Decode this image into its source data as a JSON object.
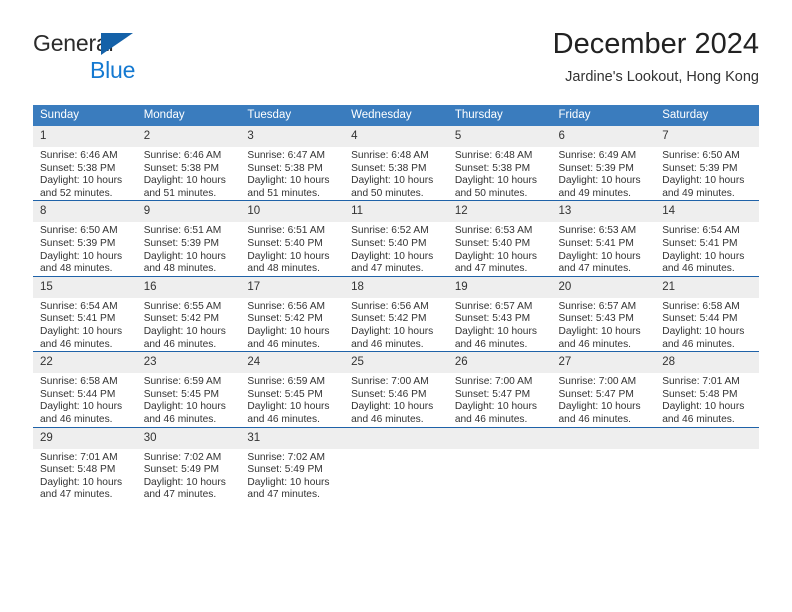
{
  "brand": {
    "name_part1": "General",
    "name_part2": "Blue",
    "flag_icon": "triangle-flag-icon",
    "color_dark": "#2b2b2b",
    "color_blue": "#1479d1",
    "flag_color": "#1461a8"
  },
  "header": {
    "month_title": "December 2024",
    "location": "Jardine's Lookout, Hong Kong"
  },
  "theme": {
    "header_bg": "#3a7cbe",
    "header_text": "#ffffff",
    "row_divider": "#1f62a8",
    "daynum_band": "#eeeeee",
    "body_text": "#333333"
  },
  "calendar": {
    "weekday_headers": [
      "Sunday",
      "Monday",
      "Tuesday",
      "Wednesday",
      "Thursday",
      "Friday",
      "Saturday"
    ],
    "weeks": [
      [
        {
          "day": "1",
          "sunrise": "Sunrise: 6:46 AM",
          "sunset": "Sunset: 5:38 PM",
          "daylight": "Daylight: 10 hours and 52 minutes."
        },
        {
          "day": "2",
          "sunrise": "Sunrise: 6:46 AM",
          "sunset": "Sunset: 5:38 PM",
          "daylight": "Daylight: 10 hours and 51 minutes."
        },
        {
          "day": "3",
          "sunrise": "Sunrise: 6:47 AM",
          "sunset": "Sunset: 5:38 PM",
          "daylight": "Daylight: 10 hours and 51 minutes."
        },
        {
          "day": "4",
          "sunrise": "Sunrise: 6:48 AM",
          "sunset": "Sunset: 5:38 PM",
          "daylight": "Daylight: 10 hours and 50 minutes."
        },
        {
          "day": "5",
          "sunrise": "Sunrise: 6:48 AM",
          "sunset": "Sunset: 5:38 PM",
          "daylight": "Daylight: 10 hours and 50 minutes."
        },
        {
          "day": "6",
          "sunrise": "Sunrise: 6:49 AM",
          "sunset": "Sunset: 5:39 PM",
          "daylight": "Daylight: 10 hours and 49 minutes."
        },
        {
          "day": "7",
          "sunrise": "Sunrise: 6:50 AM",
          "sunset": "Sunset: 5:39 PM",
          "daylight": "Daylight: 10 hours and 49 minutes."
        }
      ],
      [
        {
          "day": "8",
          "sunrise": "Sunrise: 6:50 AM",
          "sunset": "Sunset: 5:39 PM",
          "daylight": "Daylight: 10 hours and 48 minutes."
        },
        {
          "day": "9",
          "sunrise": "Sunrise: 6:51 AM",
          "sunset": "Sunset: 5:39 PM",
          "daylight": "Daylight: 10 hours and 48 minutes."
        },
        {
          "day": "10",
          "sunrise": "Sunrise: 6:51 AM",
          "sunset": "Sunset: 5:40 PM",
          "daylight": "Daylight: 10 hours and 48 minutes."
        },
        {
          "day": "11",
          "sunrise": "Sunrise: 6:52 AM",
          "sunset": "Sunset: 5:40 PM",
          "daylight": "Daylight: 10 hours and 47 minutes."
        },
        {
          "day": "12",
          "sunrise": "Sunrise: 6:53 AM",
          "sunset": "Sunset: 5:40 PM",
          "daylight": "Daylight: 10 hours and 47 minutes."
        },
        {
          "day": "13",
          "sunrise": "Sunrise: 6:53 AM",
          "sunset": "Sunset: 5:41 PM",
          "daylight": "Daylight: 10 hours and 47 minutes."
        },
        {
          "day": "14",
          "sunrise": "Sunrise: 6:54 AM",
          "sunset": "Sunset: 5:41 PM",
          "daylight": "Daylight: 10 hours and 46 minutes."
        }
      ],
      [
        {
          "day": "15",
          "sunrise": "Sunrise: 6:54 AM",
          "sunset": "Sunset: 5:41 PM",
          "daylight": "Daylight: 10 hours and 46 minutes."
        },
        {
          "day": "16",
          "sunrise": "Sunrise: 6:55 AM",
          "sunset": "Sunset: 5:42 PM",
          "daylight": "Daylight: 10 hours and 46 minutes."
        },
        {
          "day": "17",
          "sunrise": "Sunrise: 6:56 AM",
          "sunset": "Sunset: 5:42 PM",
          "daylight": "Daylight: 10 hours and 46 minutes."
        },
        {
          "day": "18",
          "sunrise": "Sunrise: 6:56 AM",
          "sunset": "Sunset: 5:42 PM",
          "daylight": "Daylight: 10 hours and 46 minutes."
        },
        {
          "day": "19",
          "sunrise": "Sunrise: 6:57 AM",
          "sunset": "Sunset: 5:43 PM",
          "daylight": "Daylight: 10 hours and 46 minutes."
        },
        {
          "day": "20",
          "sunrise": "Sunrise: 6:57 AM",
          "sunset": "Sunset: 5:43 PM",
          "daylight": "Daylight: 10 hours and 46 minutes."
        },
        {
          "day": "21",
          "sunrise": "Sunrise: 6:58 AM",
          "sunset": "Sunset: 5:44 PM",
          "daylight": "Daylight: 10 hours and 46 minutes."
        }
      ],
      [
        {
          "day": "22",
          "sunrise": "Sunrise: 6:58 AM",
          "sunset": "Sunset: 5:44 PM",
          "daylight": "Daylight: 10 hours and 46 minutes."
        },
        {
          "day": "23",
          "sunrise": "Sunrise: 6:59 AM",
          "sunset": "Sunset: 5:45 PM",
          "daylight": "Daylight: 10 hours and 46 minutes."
        },
        {
          "day": "24",
          "sunrise": "Sunrise: 6:59 AM",
          "sunset": "Sunset: 5:45 PM",
          "daylight": "Daylight: 10 hours and 46 minutes."
        },
        {
          "day": "25",
          "sunrise": "Sunrise: 7:00 AM",
          "sunset": "Sunset: 5:46 PM",
          "daylight": "Daylight: 10 hours and 46 minutes."
        },
        {
          "day": "26",
          "sunrise": "Sunrise: 7:00 AM",
          "sunset": "Sunset: 5:47 PM",
          "daylight": "Daylight: 10 hours and 46 minutes."
        },
        {
          "day": "27",
          "sunrise": "Sunrise: 7:00 AM",
          "sunset": "Sunset: 5:47 PM",
          "daylight": "Daylight: 10 hours and 46 minutes."
        },
        {
          "day": "28",
          "sunrise": "Sunrise: 7:01 AM",
          "sunset": "Sunset: 5:48 PM",
          "daylight": "Daylight: 10 hours and 46 minutes."
        }
      ],
      [
        {
          "day": "29",
          "sunrise": "Sunrise: 7:01 AM",
          "sunset": "Sunset: 5:48 PM",
          "daylight": "Daylight: 10 hours and 47 minutes."
        },
        {
          "day": "30",
          "sunrise": "Sunrise: 7:02 AM",
          "sunset": "Sunset: 5:49 PM",
          "daylight": "Daylight: 10 hours and 47 minutes."
        },
        {
          "day": "31",
          "sunrise": "Sunrise: 7:02 AM",
          "sunset": "Sunset: 5:49 PM",
          "daylight": "Daylight: 10 hours and 47 minutes."
        },
        {
          "day": "",
          "sunrise": "",
          "sunset": "",
          "daylight": ""
        },
        {
          "day": "",
          "sunrise": "",
          "sunset": "",
          "daylight": ""
        },
        {
          "day": "",
          "sunrise": "",
          "sunset": "",
          "daylight": ""
        },
        {
          "day": "",
          "sunrise": "",
          "sunset": "",
          "daylight": ""
        }
      ]
    ]
  }
}
